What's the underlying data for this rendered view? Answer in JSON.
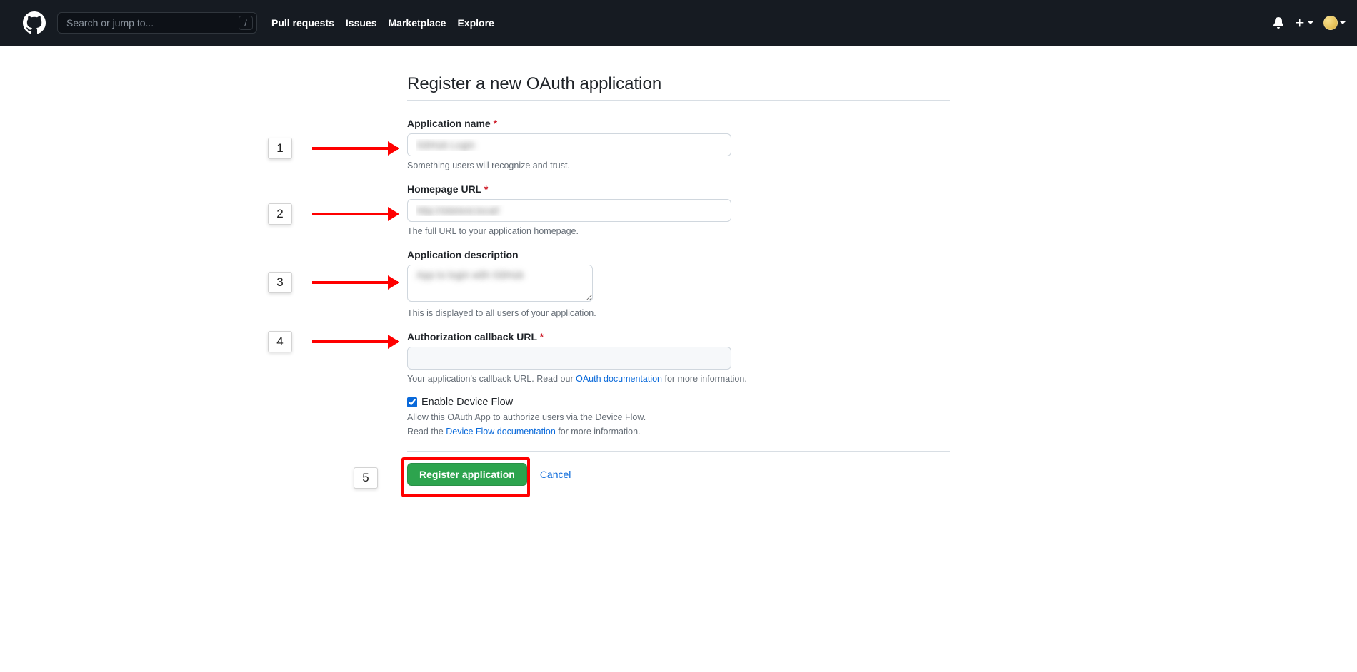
{
  "header": {
    "search_placeholder": "Search or jump to...",
    "slash": "/",
    "nav": [
      "Pull requests",
      "Issues",
      "Marketplace",
      "Explore"
    ]
  },
  "page": {
    "title": "Register a new OAuth application"
  },
  "fields": {
    "app_name": {
      "label": "Application name",
      "value": "GitHub Login",
      "note": "Something users will recognize and trust."
    },
    "homepage": {
      "label": "Homepage URL",
      "value": "http://sitetest.local/",
      "note": "The full URL to your application homepage."
    },
    "description": {
      "label": "Application description",
      "value": "App to login with GitHub",
      "note": "This is displayed to all users of your application."
    },
    "callback": {
      "label": "Authorization callback URL",
      "value": "",
      "note_before": "Your application's callback URL. Read our ",
      "note_link": "OAuth documentation",
      "note_after": " for more information."
    },
    "device_flow": {
      "label": "Enable Device Flow",
      "checked": true,
      "note1": "Allow this OAuth App to authorize users via the Device Flow.",
      "note2_before": "Read the ",
      "note2_link": "Device Flow documentation",
      "note2_after": " for more information."
    }
  },
  "actions": {
    "submit": "Register application",
    "cancel": "Cancel"
  },
  "annotations": {
    "m1": "1",
    "m2": "2",
    "m3": "3",
    "m4": "4",
    "m5": "5"
  }
}
